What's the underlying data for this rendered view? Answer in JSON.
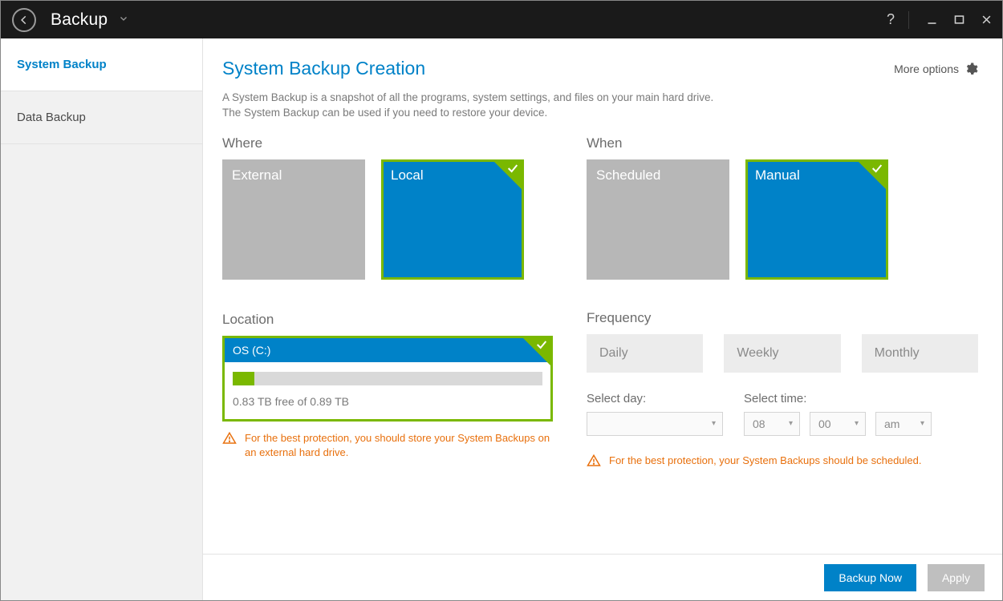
{
  "titlebar": {
    "back_label": "Back",
    "app_title": "Backup"
  },
  "sidebar": {
    "items": [
      {
        "label": "System Backup",
        "active": true
      },
      {
        "label": "Data Backup",
        "active": false
      }
    ]
  },
  "header": {
    "page_title": "System Backup Creation",
    "more_options": "More options"
  },
  "description": {
    "line1": "A System Backup is a snapshot of all the programs, system settings, and files on your main hard drive.",
    "line2": "The System Backup can be used if you need to restore your device."
  },
  "where": {
    "label": "Where",
    "options": [
      {
        "label": "External",
        "selected": false
      },
      {
        "label": "Local",
        "selected": true
      }
    ]
  },
  "when": {
    "label": "When",
    "options": [
      {
        "label": "Scheduled",
        "selected": false
      },
      {
        "label": "Manual",
        "selected": true
      }
    ]
  },
  "location": {
    "label": "Location",
    "drive_name": "OS (C:)",
    "free_text": "0.83 TB free of 0.89 TB",
    "free_tb": 0.83,
    "total_tb": 0.89,
    "used_percent": 7,
    "warning": "For the best protection, you should store your System Backups on an external hard drive."
  },
  "frequency": {
    "label": "Frequency",
    "options": [
      "Daily",
      "Weekly",
      "Monthly"
    ]
  },
  "schedule": {
    "select_day_label": "Select day:",
    "select_time_label": "Select time:",
    "day_value": "",
    "hour_value": "08",
    "minute_value": "00",
    "ampm_value": "am",
    "warning": "For the best protection, your System Backups should be scheduled."
  },
  "footer": {
    "primary": "Backup Now",
    "secondary": "Apply"
  }
}
